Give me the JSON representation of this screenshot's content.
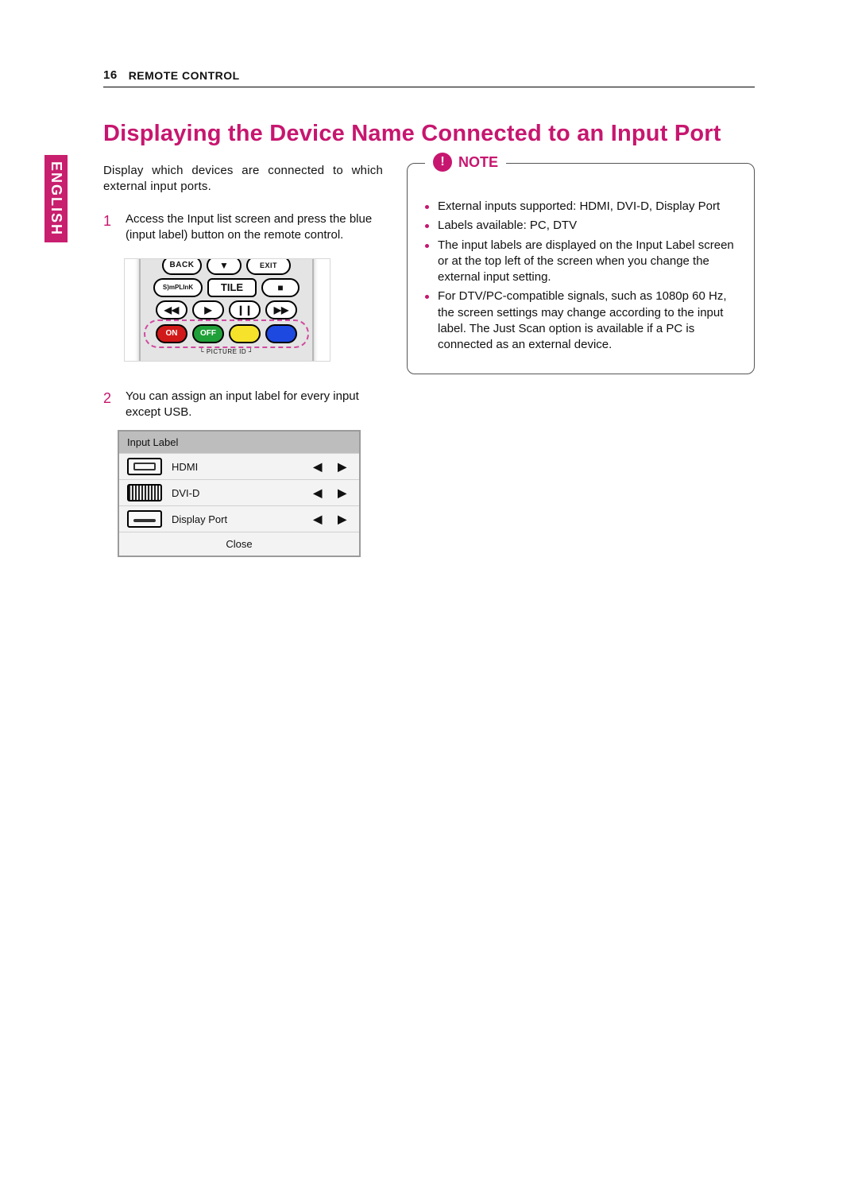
{
  "page": {
    "number": "16",
    "header": "REMOTE CONTROL",
    "language_tab": "ENGLISH",
    "title": "Displaying the Device Name Connected to an Input Port"
  },
  "left": {
    "intro": "Display which devices are connected to which external input ports.",
    "step1_num": "1",
    "step1_text": "Access the Input list screen and press the blue (input label) button on the remote control.",
    "step2_num": "2",
    "step2_text": "You can assign an input label for every input except USB."
  },
  "remote": {
    "back": "BACK",
    "down": "▼",
    "exit": "EXIT",
    "simplink": "S)mPLInK",
    "tile": "TILE",
    "stop": "■",
    "prev": "◀◀",
    "play": "▶",
    "pause": "❙❙",
    "next": "▶▶",
    "on": "ON",
    "off": "OFF",
    "picture_id": "PICTURE ID"
  },
  "panel": {
    "title": "Input Label",
    "rows": {
      "hdmi": "HDMI",
      "dvid": "DVI-D",
      "dp": "Display Port"
    },
    "left_arrow": "◀",
    "right_arrow": "▶",
    "close": "Close"
  },
  "note": {
    "title": "NOTE",
    "icon": "!",
    "items": [
      "External inputs supported: HDMI, DVI-D, Display Port",
      "Labels available: PC, DTV",
      "The input labels are displayed on the Input Label screen or at the top left of the screen when you change the external input setting.",
      "For DTV/PC-compatible signals, such as 1080p 60 Hz, the screen settings may change according to the input label. The Just Scan option is available if a PC is connected as an external device."
    ]
  }
}
